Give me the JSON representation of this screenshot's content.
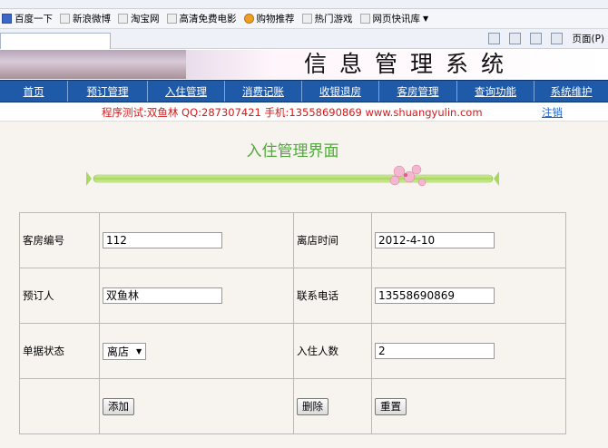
{
  "browser": {
    "favorites": [
      {
        "label": "百度一下",
        "icon": "baidu-icon"
      },
      {
        "label": "新浪微博",
        "icon": "weibo-icon"
      },
      {
        "label": "淘宝网",
        "icon": "taobao-icon"
      },
      {
        "label": "高清免费电影",
        "icon": "movie-icon"
      },
      {
        "label": "购物推荐",
        "icon": "shopping-icon"
      },
      {
        "label": "热门游戏",
        "icon": "game-icon"
      },
      {
        "label": "网页快讯库",
        "icon": "webslice-icon"
      }
    ],
    "page_menu": "页面(P)"
  },
  "banner": {
    "title": "信息管理系统"
  },
  "nav": {
    "items": [
      "首页",
      "预订管理",
      "入住管理",
      "消费记账",
      "收银退房",
      "客房管理",
      "查询功能",
      "系统维护"
    ]
  },
  "info": {
    "message": "程序测试:双鱼林 QQ:287307421 手机:13558690869 www.shuangyulin.com",
    "logout": "注销"
  },
  "page": {
    "title": "入住管理界面"
  },
  "form": {
    "room_no_label": "客房编号",
    "room_no_value": "112",
    "checkout_time_label": "离店时间",
    "checkout_time_value": "2012-4-10",
    "booker_label": "预订人",
    "booker_value": "双鱼林",
    "phone_label": "联系电话",
    "phone_value": "13558690869",
    "status_label": "单据状态",
    "status_value": "离店",
    "guests_label": "入住人数",
    "guests_value": "2",
    "add_button": "添加",
    "delete_button": "删除",
    "reset_button": "重置"
  },
  "colors": {
    "nav_bg": "#1f5aa8",
    "title_green": "#4faa3a",
    "info_red": "#d41a1a"
  }
}
